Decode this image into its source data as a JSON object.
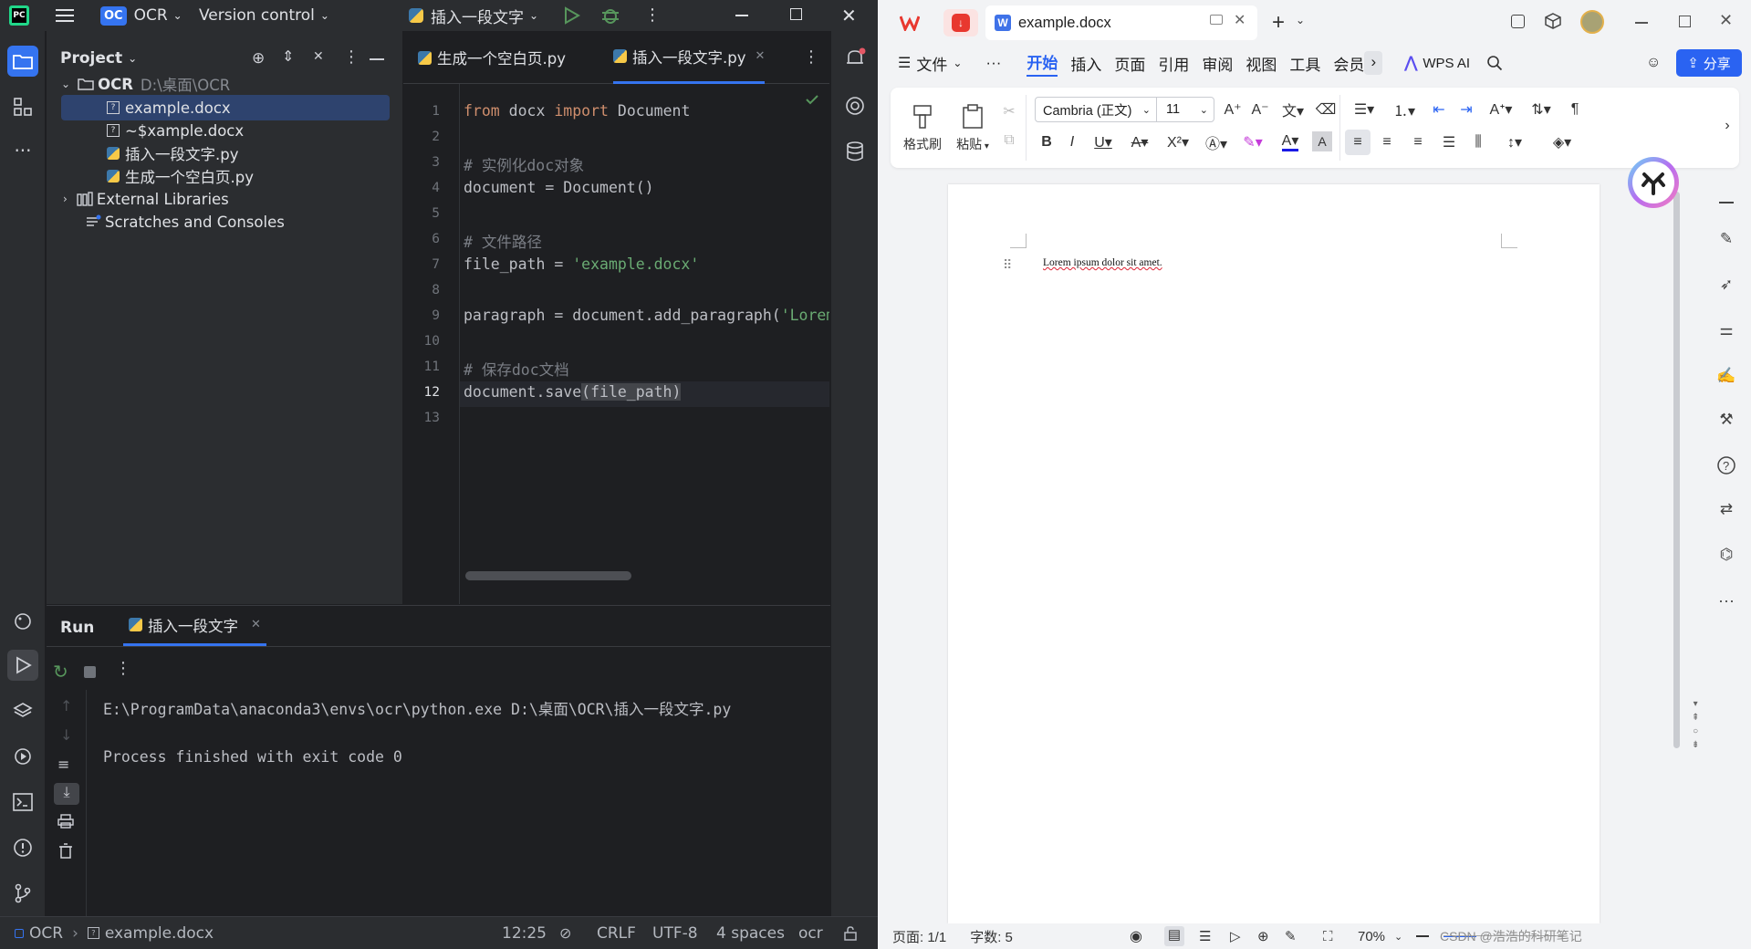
{
  "ide": {
    "project_badge": "OC",
    "project_name": "OCR",
    "version_control": "Version control",
    "run_config": "插入一段文字",
    "panel_title": "Project",
    "tree": {
      "root_name": "OCR",
      "root_path": "D:\\桌面\\OCR",
      "files": [
        "example.docx",
        "~$xample.docx",
        "插入一段文字.py",
        "生成一个空白页.py"
      ],
      "external": "External Libraries",
      "scratches": "Scratches and Consoles"
    },
    "tabs": [
      "生成一个空白页.py",
      "插入一段文字.py"
    ],
    "line_numbers": [
      "1",
      "2",
      "3",
      "4",
      "5",
      "6",
      "7",
      "8",
      "9",
      "10",
      "11",
      "12",
      "13"
    ],
    "code": {
      "l1_kw1": "from",
      "l1_mid": " docx ",
      "l1_kw2": "import",
      "l1_end": " Document",
      "l3": "# 实例化doc对象",
      "l4": "document = Document()",
      "l6": "# 文件路径",
      "l7_a": "file_path = ",
      "l7_s": "'example.docx'",
      "l9_a": "paragraph = document.add_paragraph(",
      "l9_s": "'Lorem",
      "l11": "# 保存doc文档",
      "l12_a": "document.save",
      "l12_b": "(file_path)"
    },
    "run": {
      "title": "Run",
      "tab": "插入一段文字",
      "cmd": "E:\\ProgramData\\anaconda3\\envs\\ocr\\python.exe D:\\桌面\\OCR\\插入一段文字.py",
      "result": "Process finished with exit code 0"
    },
    "status": {
      "crumb_project": "OCR",
      "crumb_file": "example.docx",
      "position": "12:25",
      "line_sep": "CRLF",
      "encoding": "UTF-8",
      "indent": "4 spaces",
      "interpreter": "ocr"
    }
  },
  "wps": {
    "doc_tab": "example.docx",
    "menu": {
      "file": "文件",
      "more": "···",
      "items": [
        "开始",
        "插入",
        "页面",
        "引用",
        "审阅",
        "视图",
        "工具",
        "会员"
      ],
      "active": "开始",
      "ai": "WPS AI",
      "share": "分享"
    },
    "ribbon": {
      "format_painter": "格式刷",
      "paste": "粘贴",
      "font": "Cambria (正文)",
      "size": "11"
    },
    "document_text": "Lorem ipsum dolor sit amet.",
    "status": {
      "page": "页面: 1/1",
      "words": "字数: 5",
      "zoom": "70%"
    },
    "watermark": "CSDN @浩浩的科研笔记"
  }
}
